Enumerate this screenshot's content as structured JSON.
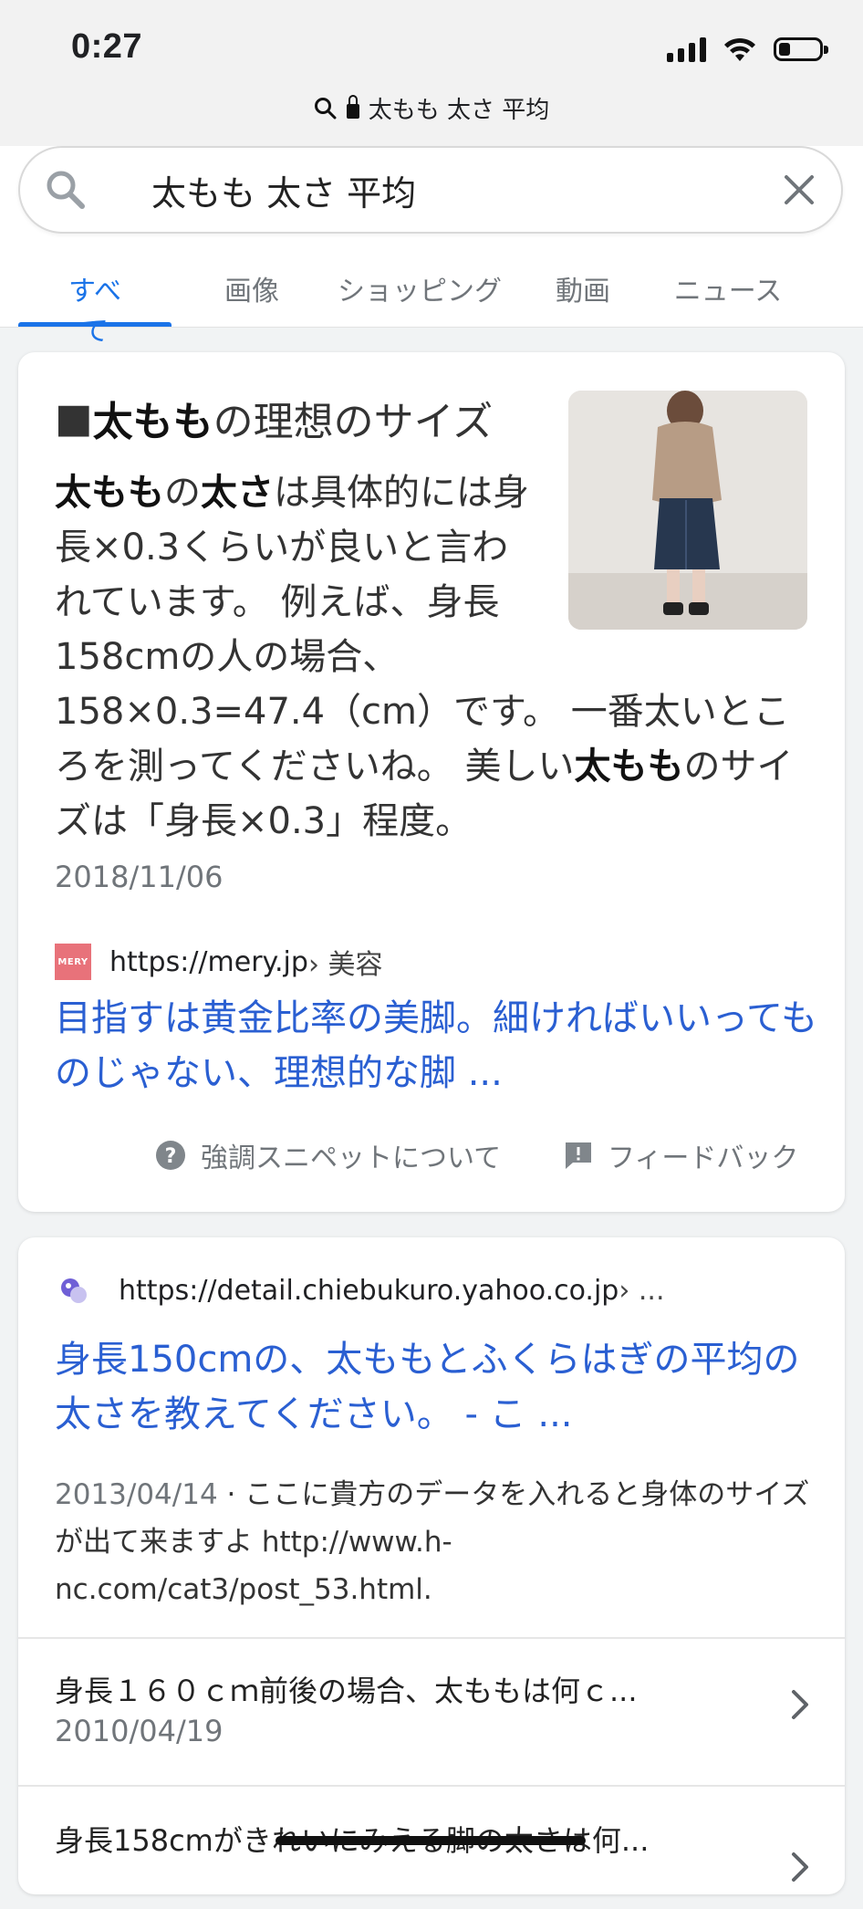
{
  "status_bar": {
    "time": "0:27",
    "url_display": "太もも 太さ 平均"
  },
  "search": {
    "query": "太もも 太さ 平均"
  },
  "tabs": [
    {
      "label": "すべて"
    },
    {
      "label": "画像"
    },
    {
      "label": "ショッピング"
    },
    {
      "label": "動画"
    },
    {
      "label": "ニュース"
    }
  ],
  "snippet": {
    "heading_prefix": "■",
    "heading_bold": "太もも",
    "heading_rest": "の理想のサイズ",
    "text_bold_1": "太もも",
    "text_1": "の",
    "text_bold_2": "太さ",
    "text_2": "は具体的には身長×0.3くらいが良いと言われています。 例えば、身長158cmの人の場合、158×0.3=47.4（cm）です。 一番太いところを測ってくださいね。 美しい",
    "text_bold_3": "太もも",
    "text_3": "のサイズは「身長×0.3」程度。",
    "date": "2018/11/06",
    "source_favicon_text": "MERY",
    "source_url": "https://mery.jp",
    "source_crumb": " › 美容",
    "title": "目指すは黄金比率の美脚。細ければいいってものじゃない、理想的な脚 ...",
    "about_label": "強調スニペットについて",
    "feedback_label": "フィードバック"
  },
  "result2": {
    "source_url": "https://detail.chiebukuro.yahoo.co.jp",
    "source_crumb": " › ...",
    "title": "身長150cmの、太ももとふくらはぎの平均の太さを教えてください。 - こ ...",
    "date": "2013/04/14",
    "description": " · ここに貴方のデータを入れると身体のサイズが出て来ますよ http://www.h-nc.com/cat3/post_53.html.",
    "sub_results": [
      {
        "title": "身長１６０ｃｍ前後の場合、太ももは何ｃ...",
        "date": "2010/04/19"
      },
      {
        "title": "身長158cmがきれいにみえる脚の太さは何...",
        "date": ""
      }
    ]
  }
}
